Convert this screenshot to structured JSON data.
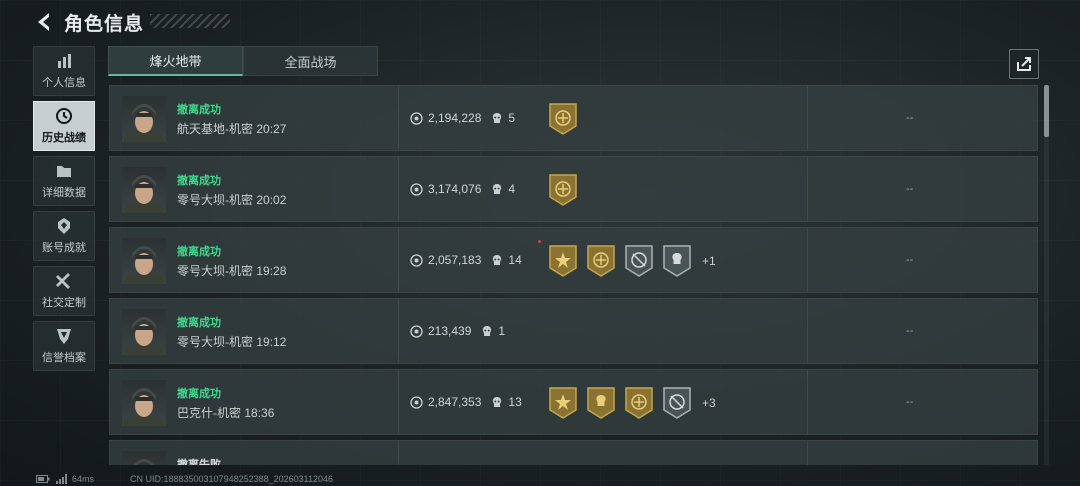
{
  "header": {
    "title": "角色信息"
  },
  "sidebar": {
    "items": [
      {
        "label": "个人信息",
        "icon": "bar-chart-icon"
      },
      {
        "label": "历史战绩",
        "icon": "clock-icon",
        "active": true
      },
      {
        "label": "详细数据",
        "icon": "folder-icon"
      },
      {
        "label": "账号成就",
        "icon": "medal-icon"
      },
      {
        "label": "社交定制",
        "icon": "tools-icon"
      },
      {
        "label": "信誉档案",
        "icon": "shield-icon"
      }
    ]
  },
  "tabs": [
    {
      "label": "烽火地带",
      "active": true
    },
    {
      "label": "全面战场",
      "active": false
    }
  ],
  "records": [
    {
      "status": "撤离成功",
      "map": "航天基地-机密",
      "time": "20:27",
      "value": "2,194,228",
      "kills": "5",
      "badges": [
        "gold-shield-badge"
      ],
      "more": "",
      "extra": "--"
    },
    {
      "status": "撤离成功",
      "map": "零号大坝-机密",
      "time": "20:02",
      "value": "3,174,076",
      "kills": "4",
      "badges": [
        "gold-shield-badge"
      ],
      "more": "",
      "extra": "--"
    },
    {
      "status": "撤离成功",
      "map": "零号大坝-机密",
      "time": "19:28",
      "value": "2,057,183",
      "kills": "14",
      "badges": [
        "gold-star-badge",
        "gold-shield-badge",
        "silver-crosshair-badge",
        "silver-skull-badge"
      ],
      "more": "+1",
      "extra": "--"
    },
    {
      "status": "撤离成功",
      "map": "零号大坝-机密",
      "time": "19:12",
      "value": "213,439",
      "kills": "1",
      "badges": [],
      "more": "",
      "extra": "--"
    },
    {
      "status": "撤离成功",
      "map": "巴克什-机密",
      "time": "18:36",
      "value": "2,847,353",
      "kills": "13",
      "badges": [
        "gold-star-badge",
        "gold-skull-badge",
        "gold-shield-badge",
        "silver-crosshair-badge"
      ],
      "more": "+3",
      "extra": "--"
    },
    {
      "status": "撤离失败",
      "map": "",
      "time": "",
      "value": "",
      "kills": "",
      "badges": [],
      "more": "",
      "extra": ""
    }
  ],
  "footer": {
    "ping": "64ms",
    "uid": "CN UID:188835003107948252388_202603112046"
  },
  "colors": {
    "success": "#3fd88e",
    "accent": "#5fb9a5",
    "gold": "#b8973f"
  }
}
